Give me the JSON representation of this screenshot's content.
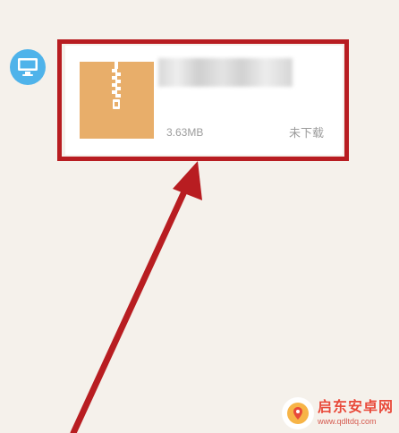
{
  "message": {
    "avatar_icon": "desktop-icon",
    "file": {
      "icon": "zip-archive-icon",
      "name": "",
      "size": "3.63MB",
      "status": "未下载"
    }
  },
  "annotation": {
    "highlight_color": "#b81d21",
    "arrow_color": "#b81d21"
  },
  "watermark": {
    "title": "启东安卓网",
    "url": "www.qdltdq.com"
  },
  "colors": {
    "background": "#f5f1eb",
    "avatar": "#4fb3ea",
    "zip_icon": "#e8ae6a",
    "secondary_text": "#9c9c9c",
    "watermark": "#e84a3a"
  }
}
